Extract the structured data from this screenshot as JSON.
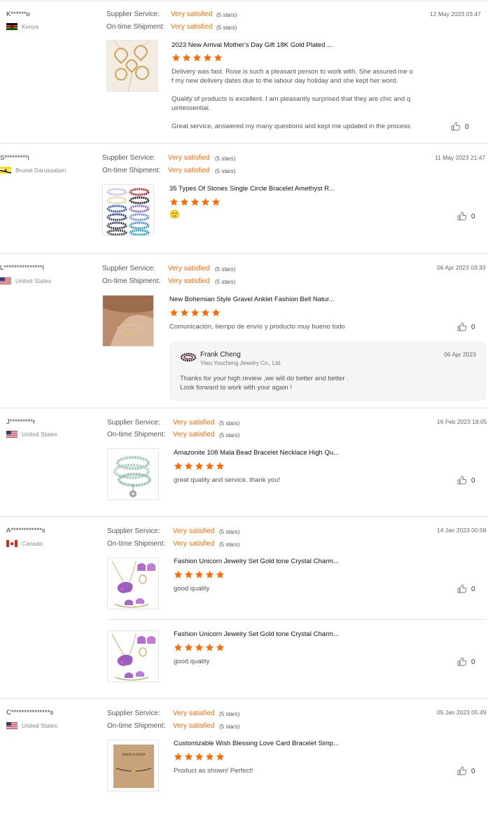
{
  "labels": {
    "supplier_service": "Supplier Service:",
    "ontime_shipment": "On-time Shipment:"
  },
  "colors": {
    "accent": "#ff6a00",
    "text": "#333333",
    "muted": "#888888",
    "separator": "#e2e2e2"
  },
  "reviews": [
    {
      "user": "K******o",
      "country": "Kenya",
      "flag_icon": "kenya-flag-icon",
      "supplier_rating": "Very satisfied",
      "supplier_stars": "(5 stars)",
      "shipment_rating": "Very satisfied",
      "shipment_stars": "(5 stars)",
      "date": "12 May 2023 03:47",
      "items": [
        {
          "title": "2023 New Arrival Mother's Day Gift 18K Gold Plated ...",
          "stars": 5,
          "text": [
            "Delivery was fast. Rose is such a pleasant person to work with. She assured me o",
            "f my new delivery dates due to the labour day holiday and she kept her word.",
            "",
            "Quality of products is excellent. I am pleasantly  surprised that they are chic and q",
            "uintessential.",
            "",
            "Great service, answered my many questions and kept me updated in the process"
          ],
          "likes": "0"
        }
      ]
    },
    {
      "user": "S*********i",
      "country": "Brunei Darussalam",
      "flag_icon": "brunei-flag-icon",
      "supplier_rating": "Very satisfied",
      "supplier_stars": "(5 stars)",
      "shipment_rating": "Very satisfied",
      "shipment_stars": "(5 stars)",
      "date": "11 May 2023 21:47",
      "items": [
        {
          "title": "35 Types Of Stones Single Circle Bracelet Amethyst R...",
          "stars": 5,
          "text": [
            "🙂"
          ],
          "likes": "0"
        }
      ]
    },
    {
      "user": "L***************l",
      "country": "United States",
      "flag_icon": "us-flag-icon",
      "supplier_rating": "Very satisfied",
      "supplier_stars": "(5 stars)",
      "shipment_rating": "Very satisfied",
      "shipment_stars": "(5 stars)",
      "date": "06 Apr 2023 03:33",
      "items": [
        {
          "title": "New Bohemian Style Gravel Anklet Fashion Bell Natur...",
          "stars": 5,
          "text": [
            "Comunicación, tiempo de envío y producto muy bueno todo"
          ],
          "likes": "0"
        }
      ],
      "reply": {
        "name": "Frank Cheng",
        "company": "Yiwu Youcheng Jewelry Co., Ltd.",
        "date": "06 Apr 2023",
        "text": [
          "Thanks for your high review ,we will do better and better .",
          "Look forward to work with your again !"
        ]
      }
    },
    {
      "user": "J*********r",
      "country": "United States",
      "flag_icon": "us-flag-icon",
      "supplier_rating": "Very satisfied",
      "supplier_stars": "(5 stars)",
      "shipment_rating": "Very satisfied",
      "shipment_stars": "(5 stars)",
      "date": "16 Feb 2023 18:05",
      "items": [
        {
          "title": "Amazonite 108 Mala Bead Bracelet Necklace High Qu...",
          "stars": 5,
          "text": [
            "great quality and service. thank you!"
          ],
          "likes": "0"
        }
      ]
    },
    {
      "user": "A************s",
      "country": "Canada",
      "flag_icon": "canada-flag-icon",
      "supplier_rating": "Very satisfied",
      "supplier_stars": "(5 stars)",
      "shipment_rating": "Very satisfied",
      "shipment_stars": "(5 stars)",
      "date": "14 Jan 2023 00:58",
      "items": [
        {
          "title": "Fashion Unicorn Jewelry Set Gold tone Crystal Charm...",
          "stars": 5,
          "text": [
            "good quality"
          ],
          "likes": "0"
        },
        {
          "title": "Fashion Unicorn Jewelry Set Gold tone Crystal Charm...",
          "stars": 5,
          "text": [
            "good quality"
          ],
          "likes": "0"
        }
      ]
    },
    {
      "user": "C***************s",
      "country": "United States",
      "flag_icon": "us-flag-icon",
      "supplier_rating": "Very satisfied",
      "supplier_stars": "(5 stars)",
      "shipment_rating": "Very satisfied",
      "shipment_stars": "(5 stars)",
      "date": "05 Jan 2023 05:49",
      "items": [
        {
          "title": "Customizable Wish Blessing Love Card Bracelet Simp...",
          "stars": 5,
          "text": [
            "Product as shown! Perfect!"
          ],
          "likes": "0",
          "card_text": "MAKE A WISH"
        }
      ]
    }
  ]
}
